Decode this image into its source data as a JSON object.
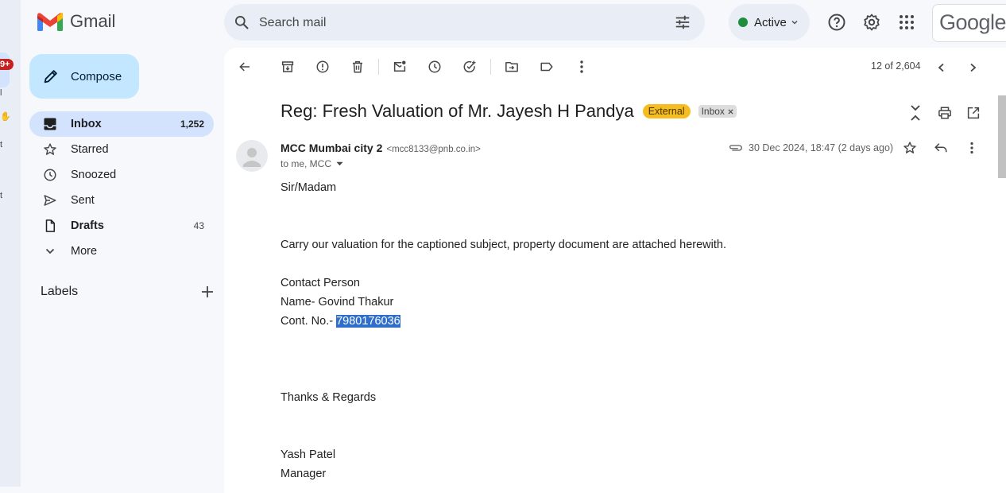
{
  "app": {
    "name": "Gmail",
    "brand_colors": [
      "#EA4335",
      "#4285F4",
      "#34A853",
      "#FBBC04"
    ]
  },
  "rail": {
    "badge": "9+",
    "fragments": [
      "l",
      "t",
      "t"
    ]
  },
  "search": {
    "placeholder": "Search mail"
  },
  "status": {
    "label": "Active",
    "color": "#1e8e3e"
  },
  "google_account": {
    "label": "Google"
  },
  "compose": {
    "label": "Compose"
  },
  "nav": [
    {
      "label": "Inbox",
      "count": "1,252",
      "icon": "inbox-icon",
      "active": true
    },
    {
      "label": "Starred",
      "count": "",
      "icon": "star-icon"
    },
    {
      "label": "Snoozed",
      "count": "",
      "icon": "clock-icon"
    },
    {
      "label": "Sent",
      "count": "",
      "icon": "send-icon"
    },
    {
      "label": "Drafts",
      "count": "43",
      "icon": "draft-icon"
    },
    {
      "label": "More",
      "count": "",
      "icon": "chevron-down-icon"
    }
  ],
  "labels": {
    "title": "Labels"
  },
  "toolbar": {
    "icons": [
      "back-arrow-icon",
      "archive-icon",
      "report-spam-icon",
      "delete-icon",
      "mark-unread-icon",
      "snooze-icon",
      "add-to-tasks-icon",
      "move-to-icon",
      "label-icon",
      "more-vert-icon"
    ],
    "counter": "12 of 2,604"
  },
  "email": {
    "subject": "Reg: Fresh Valuation of Mr. Jayesh H Pandya",
    "tags": {
      "external": "External",
      "inbox": "Inbox"
    },
    "sender_name": "MCC Mumbai city 2",
    "sender_email": "<mcc8133@pnb.co.in>",
    "to_line": "to me, MCC",
    "date": "30 Dec 2024, 18:47 (2 days ago)",
    "body": {
      "greeting": "Sir/Madam",
      "line1": "Carry our valuation for the captioned subject, property document are attached herewith.",
      "contact_heading": "Contact Person",
      "contact_name": "Name- Govind Thakur",
      "contact_no_label": "Cont. No.- ",
      "contact_no": "7980176036",
      "closing": "Thanks & Regards",
      "signer_name": "Yash Patel",
      "signer_title": "Manager"
    }
  }
}
